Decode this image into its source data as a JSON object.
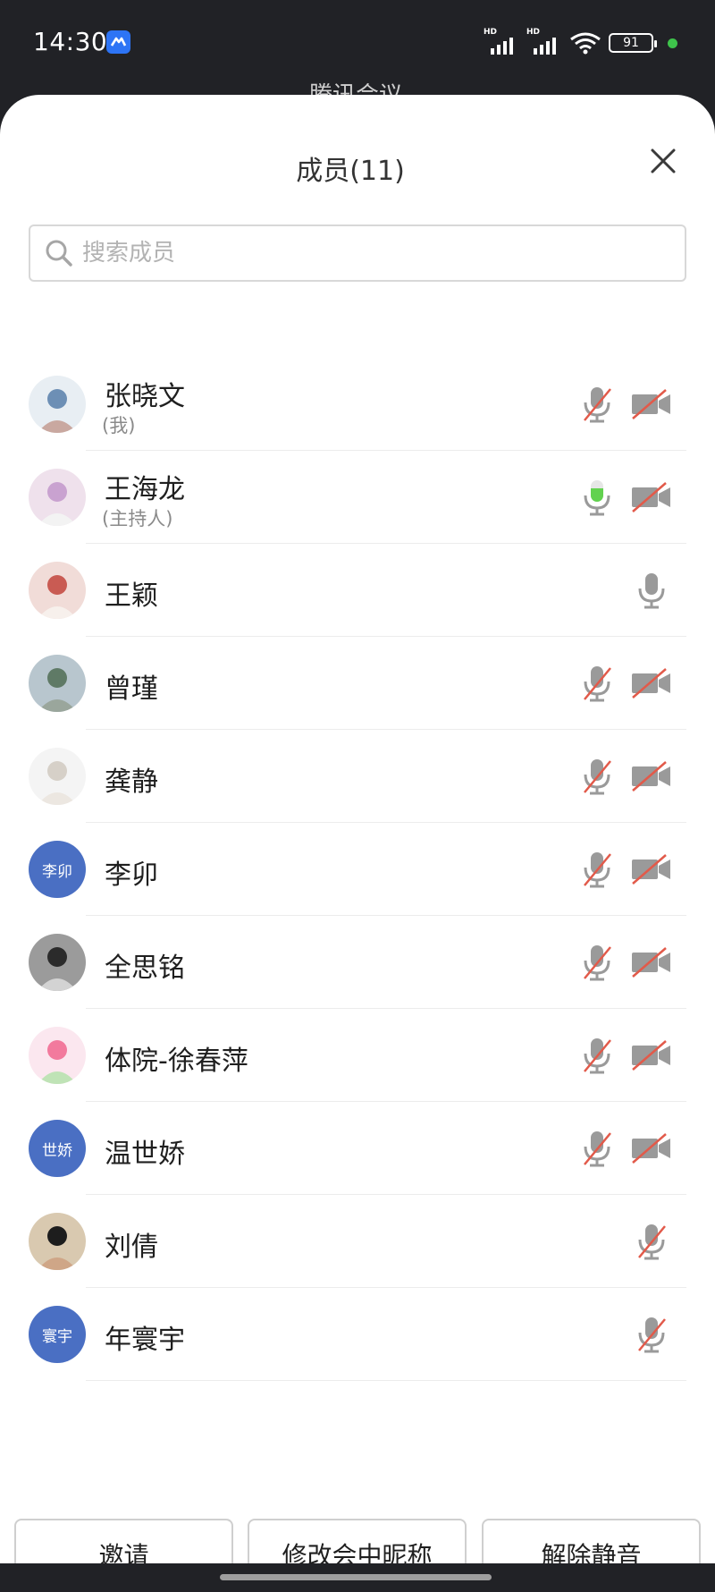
{
  "status_bar": {
    "time": "14:30",
    "signal1_label": "HD",
    "signal2_label": "HD",
    "battery_level": "91"
  },
  "background_title": "腾讯会议",
  "sheet": {
    "title": "成员(11)",
    "search_placeholder": "搜索成员"
  },
  "members": [
    {
      "name": "张晓文",
      "role": "(我)",
      "avatar": "photo",
      "mic": "muted",
      "camera": "off"
    },
    {
      "name": "王海龙",
      "role": "(主持人)",
      "avatar": "photo",
      "mic": "speaking",
      "camera": "off"
    },
    {
      "name": "王颖",
      "role": "",
      "avatar": "photo",
      "mic": "on",
      "camera": "none"
    },
    {
      "name": "曾瑾",
      "role": "",
      "avatar": "photo",
      "mic": "muted",
      "camera": "off"
    },
    {
      "name": "龚静",
      "role": "",
      "avatar": "photo",
      "mic": "muted",
      "camera": "off"
    },
    {
      "name": "李卯",
      "role": "",
      "avatar_text": "李卯",
      "mic": "muted",
      "camera": "off"
    },
    {
      "name": "全思铭",
      "role": "",
      "avatar": "photo",
      "mic": "muted",
      "camera": "off"
    },
    {
      "name": "体院-徐春萍",
      "role": "",
      "avatar": "cartoon",
      "mic": "muted",
      "camera": "off"
    },
    {
      "name": "温世娇",
      "role": "",
      "avatar_text": "世娇",
      "mic": "muted",
      "camera": "off"
    },
    {
      "name": "刘倩",
      "role": "",
      "avatar": "photo",
      "mic": "muted",
      "camera": "none"
    },
    {
      "name": "年寰宇",
      "role": "",
      "avatar_text": "寰宇",
      "mic": "muted",
      "camera": "none"
    }
  ],
  "footer": {
    "invite_label": "邀请",
    "rename_label": "修改会中昵称",
    "unmute_label": "解除静音"
  },
  "colors": {
    "accent_blue": "#4a6fc3",
    "speaking_green": "#62d24f",
    "muted_red": "#e25a4a",
    "icon_gray": "#9a9a9a"
  }
}
